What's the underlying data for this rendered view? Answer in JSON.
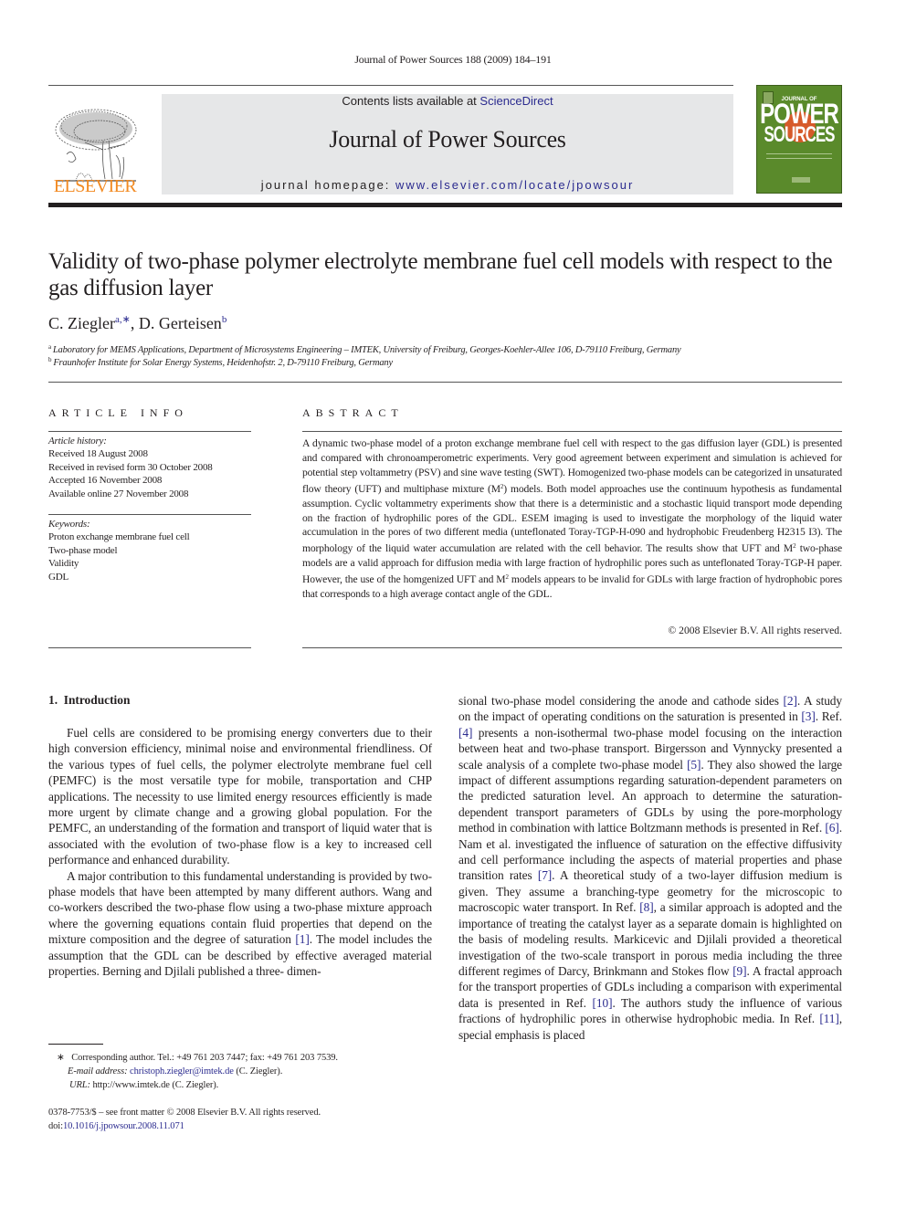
{
  "running_head": "Journal of Power Sources 188 (2009) 184–191",
  "masthead": {
    "contents_prefix": "Contents lists available at ",
    "contents_link": "ScienceDirect",
    "journal_name": "Journal of Power Sources",
    "homepage_prefix": "journal homepage: ",
    "homepage_url": "www.elsevier.com/locate/jpowsour"
  },
  "publisher": {
    "name": "ELSEVIER",
    "brand_color": "#f28a22"
  },
  "cover": {
    "line1": "JOURNAL OF",
    "line2": "POWER",
    "line3": "SOURCES",
    "color": "#5a8a2b"
  },
  "article": {
    "title": "Validity of two-phase polymer electrolyte membrane fuel cell models with respect to the gas diffusion layer",
    "authors": [
      {
        "name": "C. Ziegler",
        "marks": "a,∗"
      },
      {
        "name": "D. Gerteisen",
        "marks": "b"
      }
    ],
    "author_separator": ", ",
    "affiliations": [
      {
        "mark": "a",
        "text": "Laboratory for MEMS Applications, Department of Microsystems Engineering – IMTEK, University of Freiburg, Georges-Koehler-Allee 106, D-79110 Freiburg, Germany"
      },
      {
        "mark": "b",
        "text": "Fraunhofer Institute for Solar Energy Systems, Heidenhofstr. 2, D-79110 Freiburg, Germany"
      }
    ]
  },
  "article_info": {
    "heading": "ARTICLE INFO",
    "history_label": "Article history:",
    "history": [
      "Received 18 August 2008",
      "Received in revised form 30 October 2008",
      "Accepted 16 November 2008",
      "Available online 27 November 2008"
    ],
    "keywords_label": "Keywords:",
    "keywords": [
      "Proton exchange membrane fuel cell",
      "Two-phase model",
      "Validity",
      "GDL"
    ]
  },
  "abstract": {
    "heading": "ABSTRACT",
    "part1": "A dynamic two-phase model of a proton exchange membrane fuel cell with respect to the gas diffusion layer (GDL) is presented and compared with chronoamperometric experiments. Very good agreement between experiment and simulation is achieved for potential step voltammetry (PSV) and sine wave testing (SWT). Homogenized two-phase models can be categorized in unsaturated flow theory (UFT) and multiphase mixture (M",
    "part2": ") models. Both model approaches use the continuum hypothesis as fundamental assumption. Cyclic voltammetry experiments show that there is a deterministic and a stochastic liquid transport mode depending on the fraction of hydrophilic pores of the GDL. ESEM imaging is used to investigate the morphology of the liquid water accumulation in the pores of two different media (unteflonated Toray-TGP-H-090 and hydrophobic Freudenberg H2315 I3). The morphology of the liquid water accumulation are related with the cell behavior. The results show that UFT and M",
    "part3": " two-phase models are a valid approach for diffusion media with large fraction of hydrophilic pores such as unteflonated Toray-TGP-H paper. However, the use of the homgenized UFT and M",
    "part4": " models appears to be invalid for GDLs with large fraction of hydrophobic pores that corresponds to a high average contact angle of the GDL.",
    "superscript": "2",
    "copyright": "© 2008 Elsevier B.V. All rights reserved."
  },
  "introduction": {
    "heading": "1.  Introduction",
    "p1": "Fuel cells are considered to be promising energy converters due to their high conversion efficiency, minimal noise and environmental friendliness. Of the various types of fuel cells, the polymer electrolyte membrane fuel cell (PEMFC) is the most versatile type for mobile, transportation and CHP applications. The necessity to use limited energy resources efficiently is made more urgent by climate change and a growing global population. For the PEMFC, an understanding of the formation and transport of liquid water that is associated with the evolution of two-phase flow is a key to increased cell performance and enhanced durability.",
    "p2_a": "A major contribution to this fundamental understanding is provided by two-phase models that have been attempted by many different authors. Wang and co-workers described the two-phase flow using a two-phase mixture approach where the governing equations contain fluid properties that depend on the mixture composition and the degree of saturation ",
    "p2_b": ". The model includes the assumption that the GDL can be described by effective averaged material properties. Berning and Djilali published a three- dimensional two-phase model considering the anode and cathode sides ",
    "p2_c": ". A study on the impact of operating conditions on the saturation is presented in ",
    "p2_d": ". Ref. ",
    "p2_e": " presents a non-isothermal two-phase model focusing on the interaction between heat and two-phase transport. Birgersson and Vynnycky presented a scale analysis of a complete two-phase model ",
    "p2_f": ". They also showed the large impact of different assumptions regarding saturation-dependent parameters on the predicted saturation level. An approach to determine the saturation-dependent transport parameters of GDLs by using the pore-morphology method in combination with lattice Boltzmann methods is presented in Ref. ",
    "p2_g": ". Nam et al. investigated the influence of saturation on the effective diffusivity and cell performance including the aspects of material properties and phase transition rates ",
    "p2_h": ". A theoretical study of a two-layer diffusion medium is given. They assume a branching-type geometry for the microscopic to macroscopic water transport. In Ref. ",
    "p2_i": ", a similar approach is adopted and the importance of treating the catalyst layer as a separate domain is highlighted on the basis of modeling results. Markicevic and Djilali provided a theoretical investigation of the two-scale transport in porous media including the three different regimes of Darcy, Brinkmann and Stokes flow ",
    "p2_j": ". A fractal approach for the transport properties of GDLs including a comparison with experimental data is presented in Ref. ",
    "p2_k": ". The authors study the influence of various fractions of hydrophilic pores in otherwise hydrophobic media. In Ref. ",
    "p2_l": ", special emphasis is placed",
    "refs": [
      "[1]",
      "[2]",
      "[3]",
      "[4]",
      "[5]",
      "[6]",
      "[7]",
      "[8]",
      "[9]",
      "[10]",
      "[11]"
    ]
  },
  "footnotes": {
    "star": "∗",
    "corresponding": "Corresponding author. Tel.: +49 761 203 7447; fax: +49 761 203 7539.",
    "email_label": "E-mail address:",
    "email": "christoph.ziegler@imtek.de",
    "email_suffix": " (C. Ziegler).",
    "url_label": "URL:",
    "url": " http://www.imtek.de (C. Ziegler).",
    "front_matter": "0378-7753/$ – see front matter © 2008 Elsevier B.V. All rights reserved.",
    "doi_label": "doi:",
    "doi": "10.1016/j.jpowsour.2008.11.071"
  }
}
